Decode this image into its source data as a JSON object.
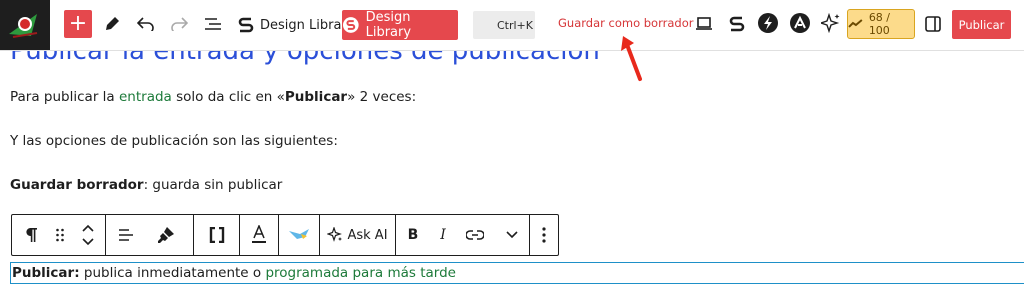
{
  "toolbar": {
    "add_label": "+",
    "design_library_plain": "Design Library",
    "design_library_red": "Design Library",
    "command_shortcut": "Ctrl+K",
    "save_draft": "Guardar como borrador",
    "score": "68 / 100",
    "publish": "Publicar"
  },
  "content": {
    "heading": "Publicar la entrada y opciones de publicación",
    "p1_before": "Para publicar la ",
    "p1_link": "entrada",
    "p1_mid": " solo da clic en «",
    "p1_bold": "Publicar",
    "p1_after": "» 2 veces:",
    "p2": "Y las opciones de publicación son las siguientes:",
    "p3_bold": "Guardar borrador",
    "p3_after": ": guarda sin publicar",
    "p4_bold": "Publicar:",
    "p4_mid": " publica inmediatamente o ",
    "p4_link": "programada para más tarde"
  },
  "block_toolbar": {
    "ask_ai": "Ask AI"
  },
  "colors": {
    "accent_red": "#e5484d",
    "heading_blue": "#2b4fd8",
    "link_green": "#1d7a3a",
    "score_bg": "#fcdb8b",
    "annotation_arrow": "#e8291c"
  },
  "icons": [
    "pen-icon",
    "undo-icon",
    "redo-icon",
    "list-view-icon",
    "stackable-icon",
    "preview-icon",
    "bolt-icon",
    "astra-icon",
    "sparkle-icon",
    "settings-panel-icon",
    "paragraph-icon",
    "drag-icon",
    "move-updown-icon",
    "align-icon",
    "highlighter-icon",
    "brackets-icon",
    "text-color-icon",
    "bird-icon",
    "bold-icon",
    "italic-icon",
    "link-icon",
    "chevron-down-icon",
    "more-options-icon",
    "red-arrow-annotation"
  ]
}
